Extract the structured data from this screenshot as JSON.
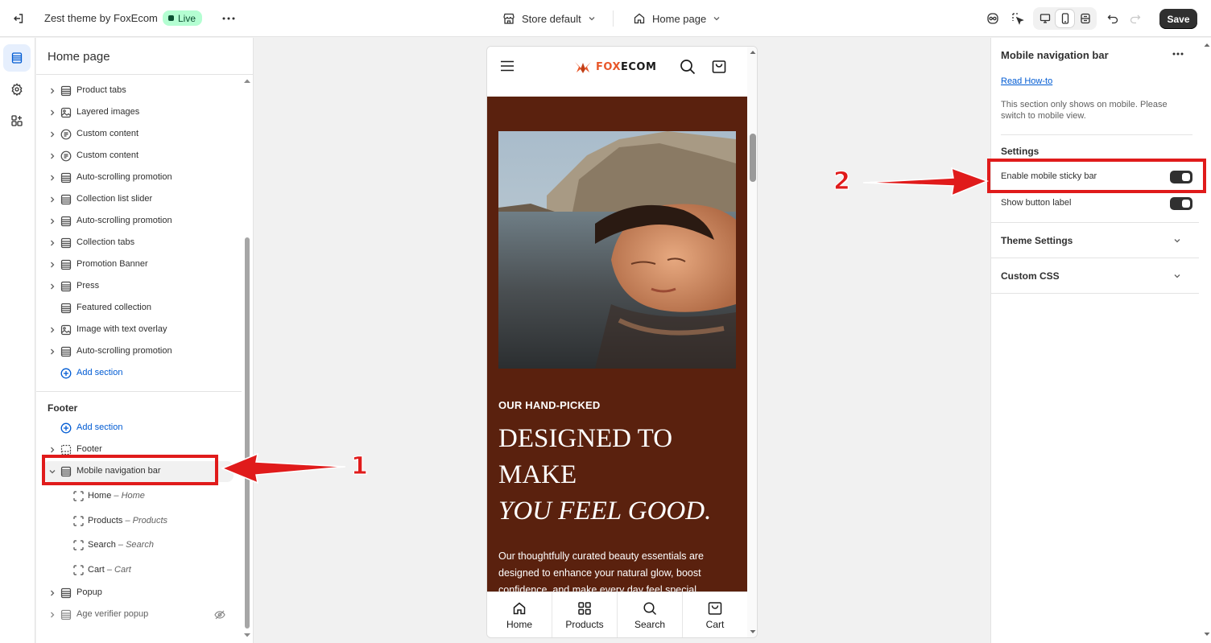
{
  "topbar": {
    "theme_name": "Zest theme by FoxEcom",
    "live_badge": "Live",
    "store_selector": "Store default",
    "page_selector": "Home page",
    "save_label": "Save"
  },
  "left_panel": {
    "title": "Home page",
    "template_sections": [
      {
        "label": "Product tabs",
        "icon": "section-icon"
      },
      {
        "label": "Layered images",
        "icon": "image-icon"
      },
      {
        "label": "Custom content",
        "icon": "content-icon"
      },
      {
        "label": "Custom content",
        "icon": "content-icon"
      },
      {
        "label": "Auto-scrolling promotion",
        "icon": "section-icon"
      },
      {
        "label": "Collection list slider",
        "icon": "section-icon"
      },
      {
        "label": "Auto-scrolling promotion",
        "icon": "section-icon"
      },
      {
        "label": "Collection tabs",
        "icon": "section-icon"
      },
      {
        "label": "Promotion Banner",
        "icon": "section-icon"
      },
      {
        "label": "Press",
        "icon": "section-icon"
      },
      {
        "label": "Featured collection",
        "icon": "section-icon"
      },
      {
        "label": "Image with text overlay",
        "icon": "image-icon"
      },
      {
        "label": "Auto-scrolling promotion",
        "icon": "section-icon"
      }
    ],
    "add_section_label": "Add section",
    "footer_group_title": "Footer",
    "footer_add_section_label": "Add section",
    "footer_section": "Footer",
    "mobile_nav_section": "Mobile navigation bar",
    "mobile_nav_blocks": [
      {
        "name": "Home",
        "type": "Home"
      },
      {
        "name": "Products",
        "type": "Products"
      },
      {
        "name": "Search",
        "type": "Search"
      },
      {
        "name": "Cart",
        "type": "Cart"
      }
    ],
    "popup_section": "Popup",
    "age_verifier_section": "Age verifier popup",
    "dash": " – "
  },
  "annotations": {
    "step1": "1",
    "step2": "2",
    "color": "#e01b1b"
  },
  "preview": {
    "logo_text_accent": "FOX",
    "logo_text_rest": "ECOM",
    "eyebrow": "OUR HAND-PICKED",
    "heading_line1": "DESIGNED TO",
    "heading_line2": "MAKE",
    "heading_line3": "YOU FEEL GOOD.",
    "body": "Our thoughtfully curated beauty essentials are designed to enhance your natural glow, boost confidence, and make every day feel special.",
    "hero_background": "#5a210e",
    "nav": [
      {
        "label": "Home",
        "icon": "home-icon"
      },
      {
        "label": "Products",
        "icon": "grid-icon"
      },
      {
        "label": "Search",
        "icon": "search-icon"
      },
      {
        "label": "Cart",
        "icon": "cart-icon"
      }
    ]
  },
  "right_panel": {
    "title": "Mobile navigation bar",
    "link": "Read How-to",
    "note": "This section only shows on mobile. Please switch to mobile view.",
    "settings_heading": "Settings",
    "options": [
      {
        "label": "Enable mobile sticky bar",
        "enabled": true
      },
      {
        "label": "Show button label",
        "enabled": true
      }
    ],
    "accordions": [
      "Theme Settings",
      "Custom CSS"
    ]
  },
  "colors": {
    "accent_blue": "#005bd3",
    "live_green": "#b4fed2",
    "save_bg": "#303030"
  }
}
